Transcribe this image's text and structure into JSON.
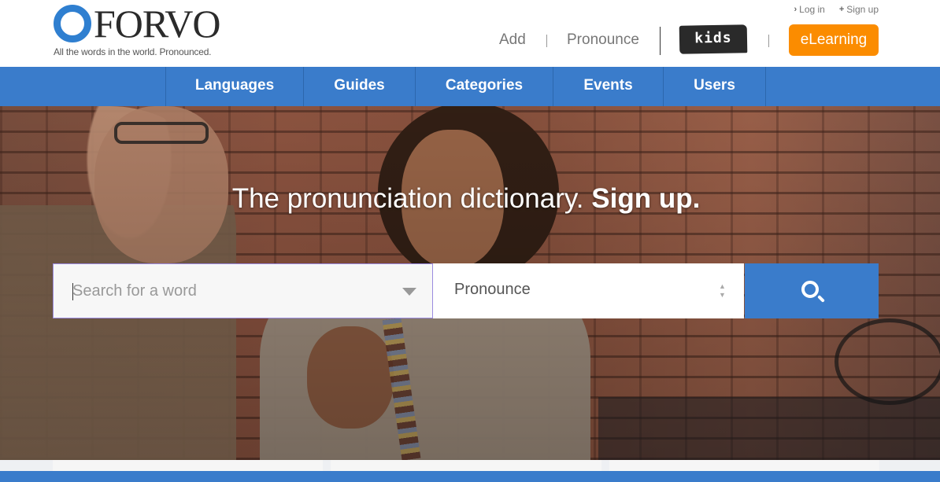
{
  "brand": {
    "name": "FORVO",
    "tagline": "All the words in the world. Pronounced."
  },
  "top_links": {
    "login": "Log in",
    "signup": "Sign up"
  },
  "header_nav": {
    "add": "Add",
    "pronounce": "Pronounce",
    "kids": "kids",
    "elearning": "eLearning"
  },
  "main_nav": [
    "Languages",
    "Guides",
    "Categories",
    "Events",
    "Users"
  ],
  "hero": {
    "title": "The pronunciation dictionary.",
    "title_emphasis": "Sign up."
  },
  "search": {
    "placeholder": "Search for a word",
    "value": "",
    "mode": "Pronounce",
    "button": "search-icon"
  },
  "colors": {
    "brand_blue": "#3a7ccb",
    "elearning_orange": "#fb8c00",
    "kids_black": "#2a2a2a"
  }
}
